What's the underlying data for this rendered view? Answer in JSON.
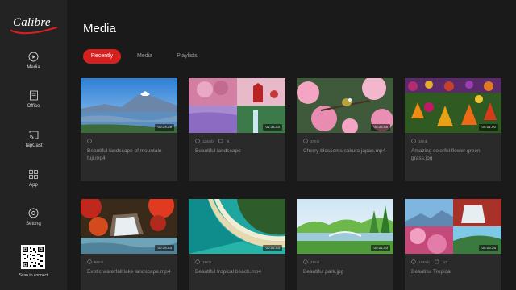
{
  "app": {
    "logo_text": "Calibre"
  },
  "sidebar": {
    "items": [
      {
        "label": "Media",
        "icon": "play-circle-icon"
      },
      {
        "label": "Office",
        "icon": "document-icon"
      },
      {
        "label": "TapCast",
        "icon": "cast-icon"
      },
      {
        "label": "App",
        "icon": "apps-grid-icon"
      },
      {
        "label": "Setting",
        "icon": "gear-icon"
      }
    ],
    "qr_label": "Scan to connect"
  },
  "main": {
    "title": "Media",
    "tabs": [
      {
        "label": "Recently",
        "active": true
      },
      {
        "label": "Media",
        "active": false
      },
      {
        "label": "Playlists",
        "active": false
      }
    ]
  },
  "cards": [
    {
      "title": "Beautiful landscape of mountain fuji.mp4",
      "duration": "00:34:29",
      "meta_size": "",
      "meta_count": ""
    },
    {
      "title": "Beautiful landscape",
      "duration": "01:34:53",
      "meta_size": "124mb",
      "meta_count": "5"
    },
    {
      "title": "Cherry blossoms sakura japan.mp4",
      "duration": "00:02:56",
      "meta_size": "27mb",
      "meta_count": ""
    },
    {
      "title": "Amazing colorful flower green grass.jpg",
      "duration": "00:01:50",
      "meta_size": "19mb",
      "meta_count": ""
    },
    {
      "title": "Exotic waterfall lake landscape.mp4",
      "duration": "00:16:53",
      "meta_size": "98mb",
      "meta_count": ""
    },
    {
      "title": "Beautiful tropical beach.mp4",
      "duration": "00:02:53",
      "meta_size": "19mb",
      "meta_count": ""
    },
    {
      "title": "Beautiful park.jpg",
      "duration": "00:01:03",
      "meta_size": "21mb",
      "meta_count": ""
    },
    {
      "title": "Beautiful Tropical",
      "duration": "00:05:26",
      "meta_size": "124mb",
      "meta_count": "12"
    }
  ],
  "colors": {
    "accent": "#d6201f",
    "sidebar_bg": "#232323",
    "main_bg": "#1a1a1a",
    "card_bg": "#2a2a2a"
  }
}
